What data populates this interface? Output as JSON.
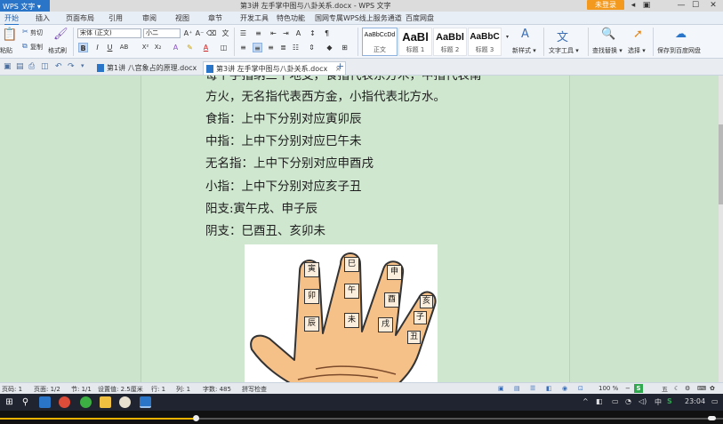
{
  "titlebar": {
    "app_menu": "WPS 文字 ▾",
    "doc_title": "第3讲 左手掌中图与八卦关系.docx - WPS 文字",
    "login": "未登录",
    "controls": [
      "◂",
      "▣",
      "—",
      "☐",
      "✕"
    ]
  },
  "menu_tabs": [
    "开始",
    "插入",
    "页面布局",
    "引用",
    "审阅",
    "视图",
    "章节",
    "开发工具",
    "特色功能",
    "国网专属WPS线上服务通道",
    "百度网盘"
  ],
  "ribbon": {
    "paste_label": "粘贴",
    "cut_label": "剪切",
    "copy_label": "复制",
    "format_painter_label": "格式刷",
    "font_name": "宋体 (正文)",
    "font_size": "小二",
    "styles": [
      {
        "sample": "AaBbCcDd",
        "label": "正文"
      },
      {
        "sample": "AaBl",
        "label": "标题 1"
      },
      {
        "sample": "AaBbl",
        "label": "标题 2"
      },
      {
        "sample": "AaBbC",
        "label": "标题 3"
      }
    ],
    "new_style": "新样式 ▾",
    "text_tools": "文字工具 ▾",
    "find_replace": "查找替换 ▾",
    "select": "选择 ▾",
    "save_to_baidu": "保存到百度网盘"
  },
  "doc_tabs": [
    {
      "label": "第1讲 八宫象占的原理.docx",
      "active": false
    },
    {
      "label": "第3讲 左手掌中图与八卦关系.docx",
      "active": true
    }
  ],
  "document": {
    "lines": [
      "每个手指纳三个地支，食指代表东方木，中指代表南",
      "方火，无名指代表西方金，小指代表北方水。",
      "食指：上中下分别对应寅卯辰",
      "中指：上中下分别对应巳午未",
      "无名指：上中下分别对应申酉戌",
      "小指：上中下分别对应亥子丑",
      "阳支:寅午戌、申子辰",
      "阴支：巳酉丑、亥卯未"
    ],
    "hand_labels": {
      "index": [
        "寅",
        "卯",
        "辰"
      ],
      "middle": [
        "巳",
        "午",
        "未"
      ],
      "ring": [
        "申",
        "酉",
        "戌"
      ],
      "little": [
        "亥",
        "子",
        "丑"
      ]
    }
  },
  "status_bar": {
    "items": [
      "页码: 1",
      "页面: 1/2",
      "节: 1/1",
      "设置值: 2.5厘米",
      "行: 1",
      "列: 1",
      "字数: 485",
      "拼写检查"
    ],
    "zoom": "100 %",
    "ime": "五"
  },
  "taskbar": {
    "time": "23:04",
    "ime": "中"
  },
  "player": {
    "progress": 0.27
  },
  "colors": {
    "accent": "#2b75c8",
    "login": "#f39a1e",
    "page_bg": "#cfe6cf",
    "skin": "#f6c089"
  }
}
